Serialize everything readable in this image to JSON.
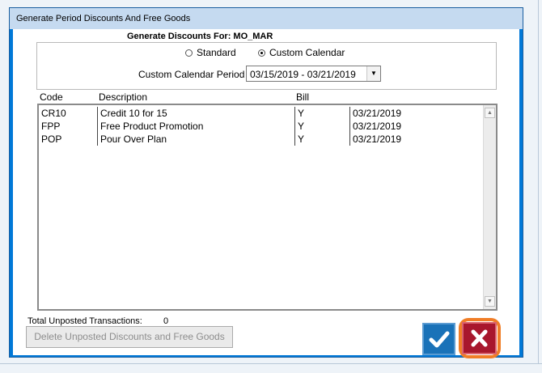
{
  "window": {
    "title": "Generate Period Discounts And Free Goods"
  },
  "header": {
    "label": "Generate Discounts For:",
    "value": "MO_MAR"
  },
  "calendar": {
    "standard_label": "Standard",
    "custom_label": "Custom Calendar",
    "selected": "Custom Calendar",
    "period_label": "Custom Calendar Period",
    "period_value": "03/15/2019 - 03/21/2019"
  },
  "table": {
    "columns": [
      "Code",
      "Description",
      "Bill",
      ""
    ],
    "rows": [
      {
        "code": "CR10",
        "description": "Credit 10 for 15",
        "bill": "Y",
        "date": "03/21/2019"
      },
      {
        "code": "FPP",
        "description": "Free Product Promotion",
        "bill": "Y",
        "date": "03/21/2019"
      },
      {
        "code": "POP",
        "description": "Pour Over Plan",
        "bill": "Y",
        "date": "03/21/2019"
      }
    ]
  },
  "footer": {
    "total_label": "Total Unposted Transactions:",
    "total_value": "0",
    "delete_label": "Delete Unposted Discounts and Free Goods",
    "ok_icon": "checkmark-icon",
    "cancel_icon": "close-x-icon"
  },
  "colors": {
    "ok": "#1a72b8",
    "cancel": "#a8172d",
    "highlight": "#f07d27"
  }
}
